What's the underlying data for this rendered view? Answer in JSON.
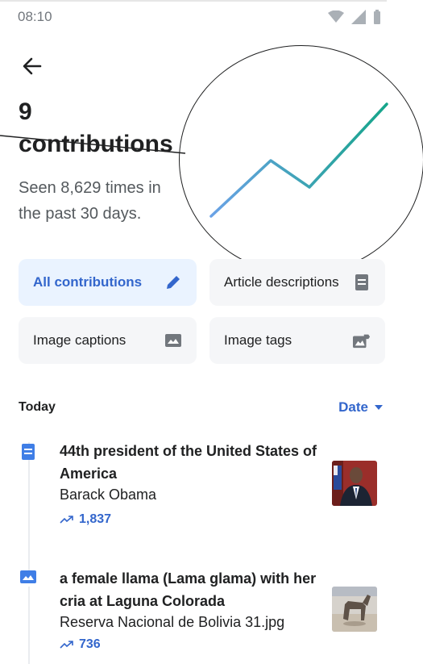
{
  "status": {
    "time": "08:10"
  },
  "header": {
    "count": "9",
    "label": "contributions",
    "subtitle": "Seen 8,629 times in the past 30 days."
  },
  "filters": [
    {
      "label": "All contributions",
      "icon": "pencil-icon",
      "active": true
    },
    {
      "label": "Article descriptions",
      "icon": "article-description-icon",
      "active": false
    },
    {
      "label": "Image captions",
      "icon": "image-caption-icon",
      "active": false
    },
    {
      "label": "Image tags",
      "icon": "image-tag-icon",
      "active": false
    }
  ],
  "list": {
    "section": "Today",
    "sort_label": "Date",
    "items": [
      {
        "description": "44th president of the United States of America",
        "title": "Barack Obama",
        "views": "1,837",
        "type_icon": "article-description-icon"
      },
      {
        "description": "a female llama (Lama glama) with her cria at Laguna Colorada",
        "title": "Reserva Nacional de Bolivia 31.jpg",
        "views": "736",
        "type_icon": "image-caption-icon"
      }
    ]
  },
  "colors": {
    "accent": "#3366cc",
    "chart_start": "#5b9bd5",
    "chart_end": "#14a085",
    "chip_active_bg": "#eaf3ff",
    "chip_bg": "#f5f6f8"
  }
}
